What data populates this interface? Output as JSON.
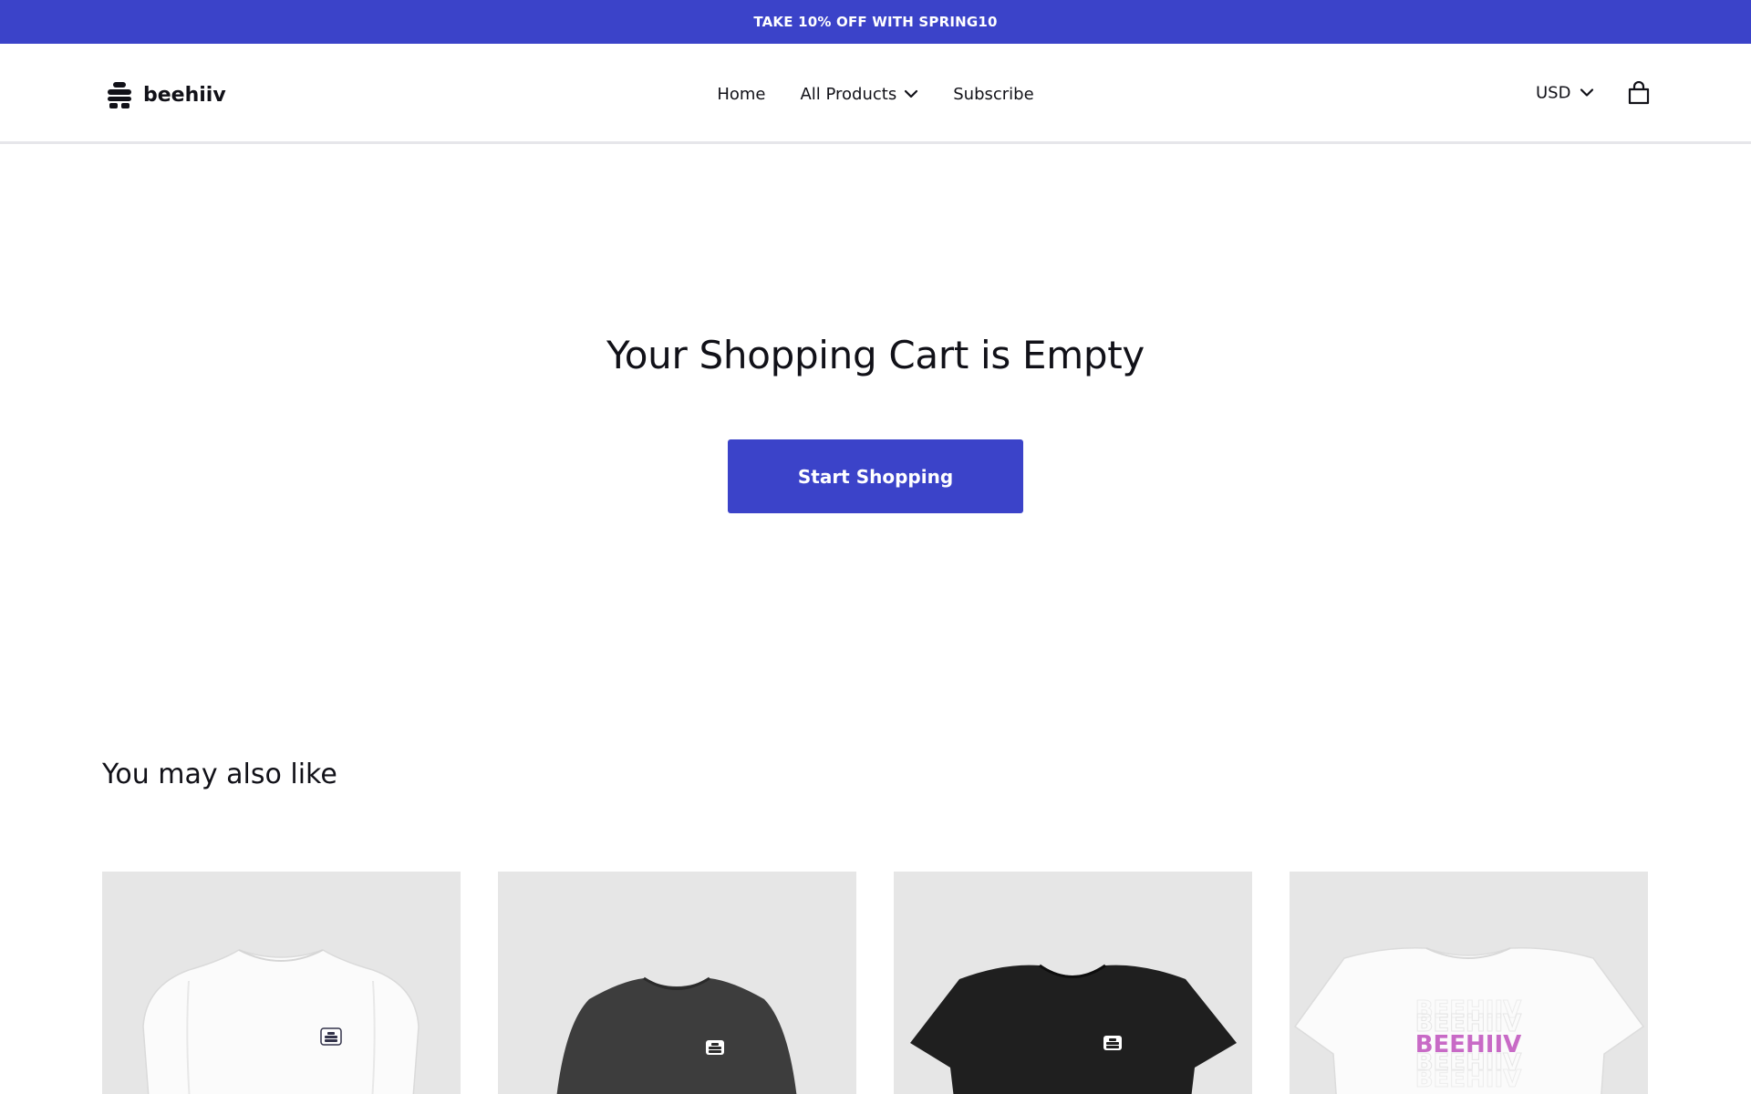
{
  "promo": {
    "text": "TAKE 10% OFF WITH SPRING10",
    "bg_color": "#3b43c9"
  },
  "header": {
    "logo": {
      "icon": "beehive-logo-icon",
      "text": "beehiiv"
    },
    "nav": [
      {
        "label": "Home",
        "has_dropdown": false
      },
      {
        "label": "All Products",
        "has_dropdown": true
      },
      {
        "label": "Subscribe",
        "has_dropdown": false
      }
    ],
    "currency": {
      "label": "USD",
      "icon": "chevron-down-icon"
    },
    "cart": {
      "icon": "shopping-bag-icon"
    }
  },
  "cart": {
    "title": "Your Shopping Cart is Empty",
    "cta_label": "Start Shopping",
    "cta_color": "#3b43c9"
  },
  "recommendations": {
    "title": "You may also like",
    "products": [
      {
        "image": "white-crewneck-sweatshirt-with-logo-patch"
      },
      {
        "image": "charcoal-crewneck-sweatshirt-with-logo-patch"
      },
      {
        "image": "black-tshirt-with-logo-patch"
      },
      {
        "image": "white-tshirt-with-pink-print",
        "print_text": "BEEHIIV"
      }
    ]
  }
}
